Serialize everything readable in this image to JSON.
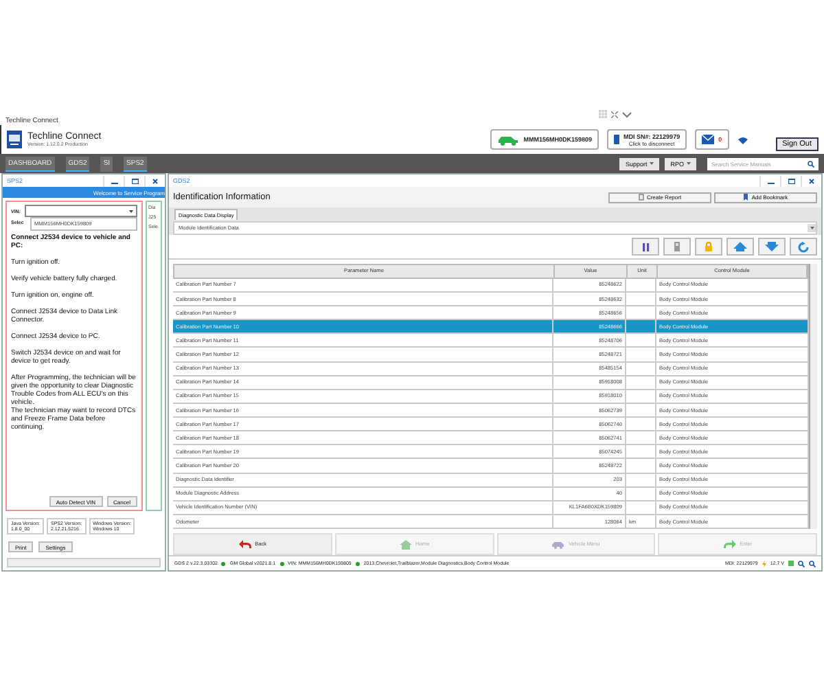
{
  "app": {
    "title": "Techline Connect",
    "brand": "Techline Connect",
    "version": "Version: 1.12.0.2 Production"
  },
  "header": {
    "vehicle": "MMM156MH0DK159809",
    "mdi_title": "MDI SN#: 22129979",
    "mdi_subtitle": "Click to disconnect",
    "mail_count": "0",
    "sign_out": "Sign Out"
  },
  "nav": {
    "tabs": [
      {
        "label": "DASHBOARD",
        "open": true
      },
      {
        "label": "GDS2",
        "open": true
      },
      {
        "label": "SI",
        "open": false
      },
      {
        "label": "SPS2",
        "open": true
      }
    ],
    "menus": [
      "Support",
      "RPO"
    ],
    "search": {
      "placeholder": "Search Service Manuals"
    }
  },
  "sps2": {
    "title": "SPS2",
    "banner": "Welcome to Service Program",
    "vin_label": "VIN:",
    "select_label": "Selec",
    "vin_option": "MMM156MH0DK159809",
    "heading": "Connect J2534 device to vehicle and PC:",
    "steps": [
      "Turn ignition off.",
      "Verify vehicle battery fully charged.",
      "Turn ignition on, engine off.",
      "Connect J2534 device to Data Link Connector.",
      "Connect J2534 device to PC.",
      "Switch J2534 device on and wait for device to get ready.",
      "After Programming, the technician will be given the opportunity to clear Diagnostic Trouble Codes from ALL ECU's on this vehicle.\nThe technician may want to record DTCs and Freeze Frame Data before continuing."
    ],
    "buttons": [
      "Auto Detect VIN",
      "Cancel"
    ],
    "side_texts": [
      "Dia",
      "J25",
      "Sele"
    ],
    "versions": [
      {
        "label": "Java Version:",
        "value": "1.8.0_00"
      },
      {
        "label": "SPS2 Version:",
        "value": "2.12.21.5216"
      },
      {
        "label": "Windows Version:",
        "value": "Windows 10"
      }
    ],
    "footer_buttons": [
      "Print",
      "Settings"
    ]
  },
  "gds2": {
    "title": "GDS2",
    "heading": "Identification Information",
    "actions": [
      "Create Report",
      "Add Bookmark"
    ],
    "tabs": [
      {
        "label": "Diagnostic Data Display",
        "selected": true
      }
    ],
    "dropdown": "Module Identification Data",
    "table": {
      "columns": [
        "Parameter Name",
        "Value",
        "Unit",
        "Control Module"
      ],
      "rows": [
        {
          "cells": [
            "Calibration Part Number 7",
            "85248622",
            "",
            "Body Control Module"
          ],
          "selected": false
        },
        {
          "cells": [
            "Calibration Part Number 8",
            "85248632",
            "",
            "Body Control Module"
          ],
          "selected": false
        },
        {
          "cells": [
            "Calibration Part Number 9",
            "85248656",
            "",
            "Body Control Module"
          ],
          "selected": false
        },
        {
          "cells": [
            "Calibration Part Number 10",
            "85248666",
            "",
            "Body Control Module"
          ],
          "selected": true
        },
        {
          "cells": [
            "Calibration Part Number 11",
            "85248706",
            "",
            "Body Control Module"
          ],
          "selected": false
        },
        {
          "cells": [
            "Calibration Part Number 12",
            "85248721",
            "",
            "Body Control Module"
          ],
          "selected": false
        },
        {
          "cells": [
            "Calibration Part Number 13",
            "85485154",
            "",
            "Body Control Module"
          ],
          "selected": false
        },
        {
          "cells": [
            "Calibration Part Number 14",
            "85918008",
            "",
            "Body Control Module"
          ],
          "selected": false
        },
        {
          "cells": [
            "Calibration Part Number 15",
            "85918010",
            "",
            "Body Control Module"
          ],
          "selected": false
        },
        {
          "cells": [
            "Calibration Part Number 16",
            "85062739",
            "",
            "Body Control Module"
          ],
          "selected": false
        },
        {
          "cells": [
            "Calibration Part Number 17",
            "85062740",
            "",
            "Body Control Module"
          ],
          "selected": false
        },
        {
          "cells": [
            "Calibration Part Number 18",
            "85062741",
            "",
            "Body Control Module"
          ],
          "selected": false
        },
        {
          "cells": [
            "Calibration Part Number 19",
            "85074245",
            "",
            "Body Control Module"
          ],
          "selected": false
        },
        {
          "cells": [
            "Calibration Part Number 20",
            "85248722",
            "",
            "Body Control Module"
          ],
          "selected": false
        },
        {
          "cells": [
            "Diagnostic Data Identifier",
            "203",
            "",
            "Body Control Module"
          ],
          "selected": false
        },
        {
          "cells": [
            "Module Diagnostic Address",
            "40",
            "",
            "Body Control Module"
          ],
          "selected": false
        },
        {
          "cells": [
            "Vehicle Identification Number (VIN)",
            "KL1FA6B0XDK159809",
            "",
            "Body Control Module"
          ],
          "selected": false
        },
        {
          "cells": [
            "Odometer",
            "128064",
            "km",
            "Body Control Module"
          ],
          "selected": false
        }
      ]
    },
    "nav_buttons": [
      {
        "kind": "back",
        "label": "Back",
        "disabled": false
      },
      {
        "kind": "home",
        "label": "Home",
        "disabled": true
      },
      {
        "kind": "menu",
        "label": "Vehicle Menu",
        "disabled": true
      },
      {
        "kind": "enter",
        "label": "Enter",
        "disabled": true
      }
    ]
  },
  "status_bar": {
    "items": [
      "GDS 2 v.22.3.03302",
      "GM Global v2021.8.1",
      "VIN: MMM156MH0DK159809",
      "2013,Chevrolet,Trailblazer,Module Diagnostics,Body Control Module"
    ],
    "mdi": "MDI: 22129979",
    "voltage": "12.7 V"
  }
}
